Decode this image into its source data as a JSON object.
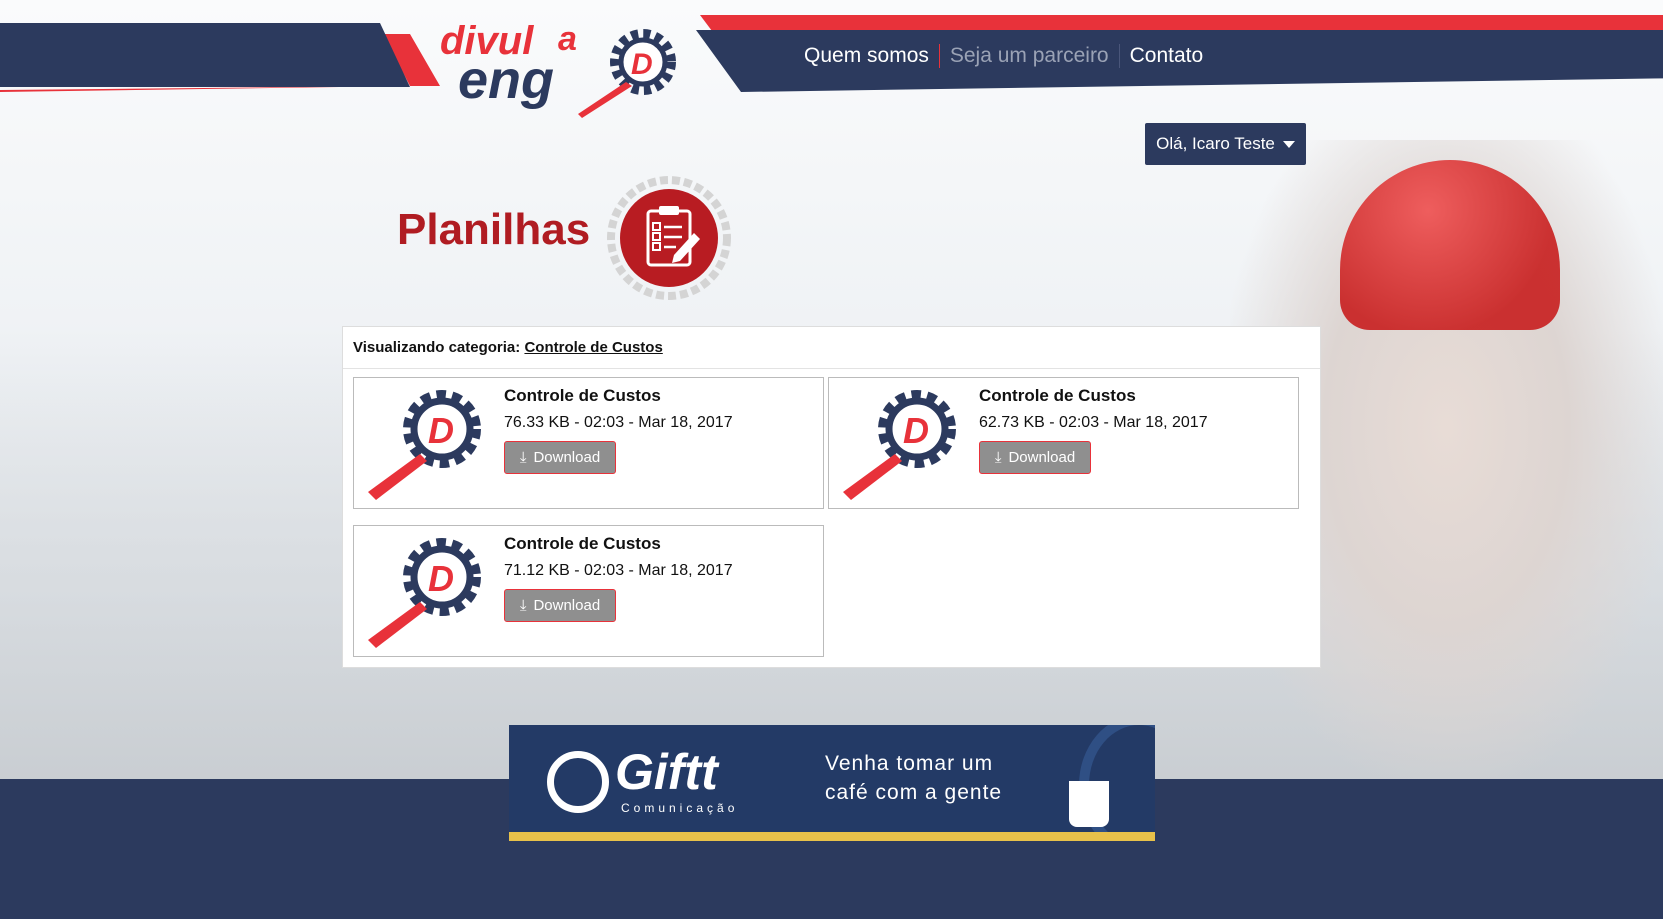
{
  "header": {
    "logo_text": "divulgaeng",
    "nav": [
      {
        "label": "Quem somos"
      },
      {
        "label": "Seja um parceiro"
      },
      {
        "label": "Contato"
      }
    ],
    "user_menu": "Olá, Icaro Teste"
  },
  "page": {
    "title": "Planilhas"
  },
  "panel": {
    "category_prefix": "Visualizando categoria:",
    "category": "Controle de Custos",
    "files": [
      {
        "title": "Controle de Custos",
        "meta": "76.33 KB - 02:03 - Mar 18, 2017",
        "button": "Download"
      },
      {
        "title": "Controle de Custos",
        "meta": "62.73 KB - 02:03 - Mar 18, 2017",
        "button": "Download"
      },
      {
        "title": "Controle de Custos",
        "meta": "71.12 KB - 02:03 - Mar 18, 2017",
        "button": "Download"
      }
    ]
  },
  "banner": {
    "brand": "Giftt",
    "sub": "Comunicação",
    "slogan_1": "Venha tomar um",
    "slogan_2": "café com a gente"
  },
  "colors": {
    "navy": "#2c3a5e",
    "red": "#e8323a",
    "title_red": "#b01c22"
  }
}
